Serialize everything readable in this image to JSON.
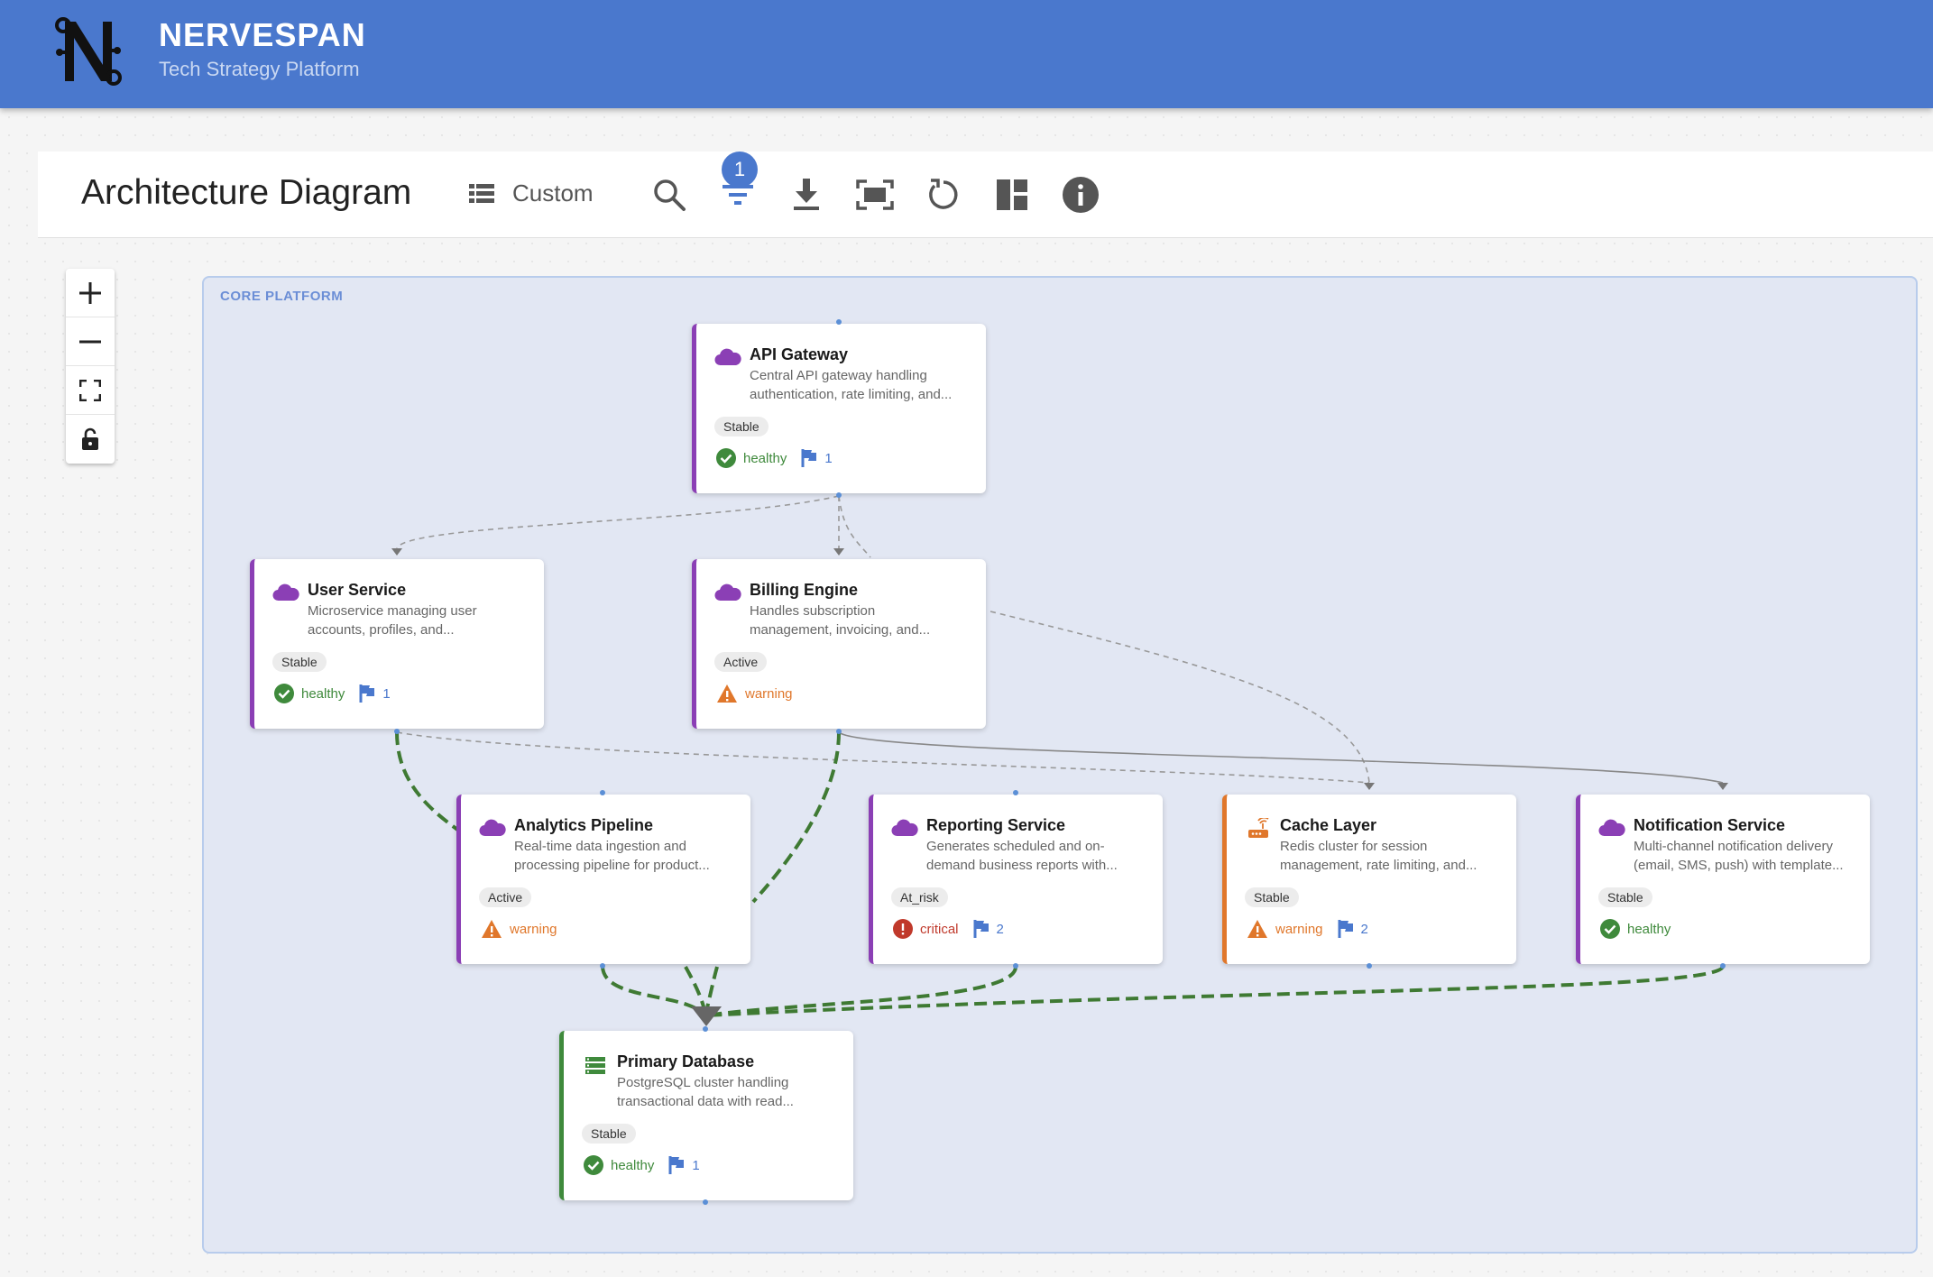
{
  "header": {
    "brand_name": "NERVESPAN",
    "brand_subtitle": "Tech Strategy Platform"
  },
  "toolbar": {
    "title": "Architecture Diagram",
    "view_label": "Custom",
    "filter_count": "1"
  },
  "group": {
    "label": "CORE PLATFORM"
  },
  "nodes": {
    "api_gateway": {
      "title": "API Gateway",
      "desc_line1": "Central API gateway handling",
      "desc_line2": "authentication, rate limiting, and...",
      "tag": "Stable",
      "status": "healthy",
      "flags": "1"
    },
    "user_service": {
      "title": "User Service",
      "desc_line1": "Microservice managing user",
      "desc_line2": "accounts, profiles, and...",
      "tag": "Stable",
      "status": "healthy",
      "flags": "1"
    },
    "billing_engine": {
      "title": "Billing Engine",
      "desc_line1": "Handles subscription",
      "desc_line2": "management, invoicing, and...",
      "tag": "Active",
      "status": "warning"
    },
    "analytics_pipeline": {
      "title": "Analytics Pipeline",
      "desc_line1": "Real-time data ingestion and",
      "desc_line2": "processing pipeline for product...",
      "tag": "Active",
      "status": "warning"
    },
    "reporting_service": {
      "title": "Reporting Service",
      "desc_line1": "Generates scheduled and on-",
      "desc_line2": "demand business reports with...",
      "tag": "At_risk",
      "status": "critical",
      "flags": "2"
    },
    "cache_layer": {
      "title": "Cache Layer",
      "desc_line1": "Redis cluster for session",
      "desc_line2": "management, rate limiting, and...",
      "tag": "Stable",
      "status": "warning",
      "flags": "2"
    },
    "notification_service": {
      "title": "Notification Service",
      "desc_line1": "Multi-channel notification delivery",
      "desc_line2": "(email, SMS, push) with template...",
      "tag": "Stable",
      "status": "healthy"
    },
    "primary_database": {
      "title": "Primary Database",
      "desc_line1": "PostgreSQL cluster handling",
      "desc_line2": "transactional data with read...",
      "tag": "Stable",
      "status": "healthy",
      "flags": "1"
    }
  },
  "icons": {
    "service": "cloud-icon",
    "cache": "router-icon",
    "database": "storage-icon"
  },
  "colors": {
    "header": "#4a78cd",
    "service_accent": "#8b3fb5",
    "cache_accent": "#e0772b",
    "database_accent": "#3f8a3c",
    "healthy": "#3f8a3c",
    "warning": "#e0772b",
    "critical": "#c0392b",
    "group_bg": "#e2e7f3"
  }
}
